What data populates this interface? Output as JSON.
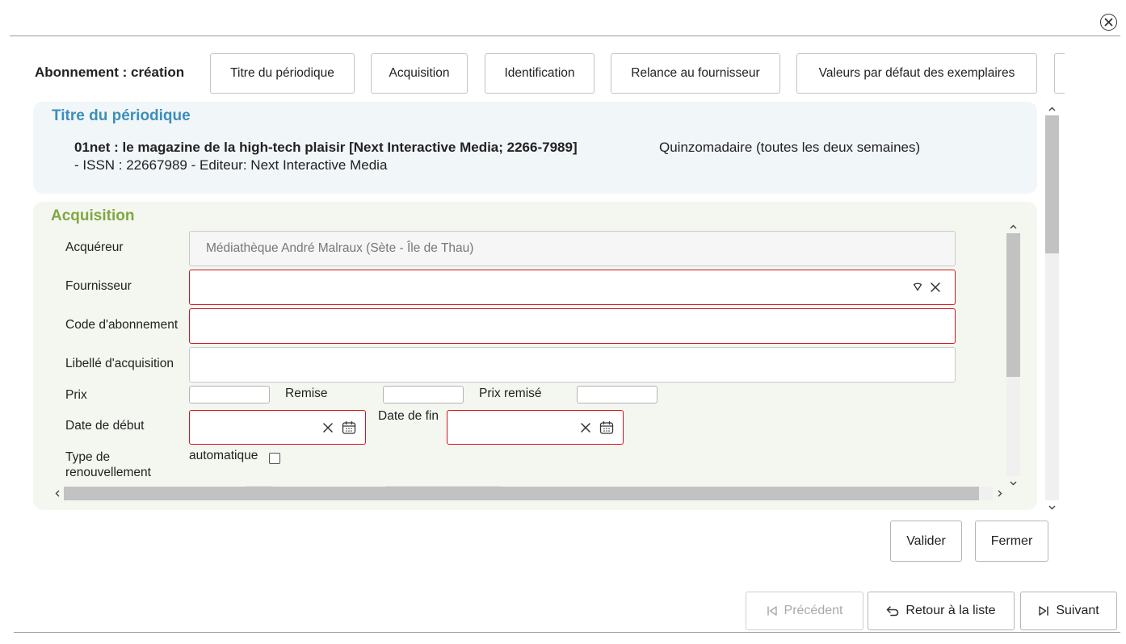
{
  "dialog": {
    "title": "Abonnement : création",
    "close_icon": "close-circle-icon"
  },
  "tabs": [
    {
      "label": "Titre du périodique"
    },
    {
      "label": "Acquisition"
    },
    {
      "label": "Identification"
    },
    {
      "label": "Relance au fournisseur"
    },
    {
      "label": "Valeurs par défaut des exemplaires"
    },
    {
      "label": ""
    }
  ],
  "titre": {
    "header": "Titre du périodique",
    "title_bold": "01net : le magazine de la high-tech plaisir [Next Interactive Media; 2266-7989]",
    "frequency": "Quinzomadaire (toutes les deux semaines)",
    "details": "- ISSN : 22667989 - Editeur: Next Interactive Media"
  },
  "acquisition": {
    "header": "Acquisition",
    "acquereur_label": "Acquéreur",
    "acquereur_value": "Médiathèque André Malraux (Sète - Île de Thau)",
    "fournisseur_label": "Fournisseur",
    "fournisseur_value": "",
    "code_label": "Code d'abonnement",
    "code_value": "",
    "libelle_label": "Libellé d'acquisition",
    "libelle_value": "",
    "prix_label": "Prix",
    "remise_label": "Remise",
    "prix_remise_label": "Prix remisé",
    "date_debut_label": "Date de début",
    "date_fin_label": "Date de fin",
    "type_renouvellement_label_1": "Type de",
    "type_renouvellement_label_2": "renouvellement",
    "automatique_label": "automatique",
    "automatique_checked": false
  },
  "actions": {
    "valider": "Valider",
    "fermer": "Fermer"
  },
  "navigation": {
    "precedent": "Précédent",
    "precedent_enabled": false,
    "retour": "Retour à la liste",
    "suivant": "Suivant"
  },
  "colors": {
    "titre_header": "#3d8fb9",
    "acquisition_header": "#80a742",
    "required_border": "#d2141e"
  }
}
